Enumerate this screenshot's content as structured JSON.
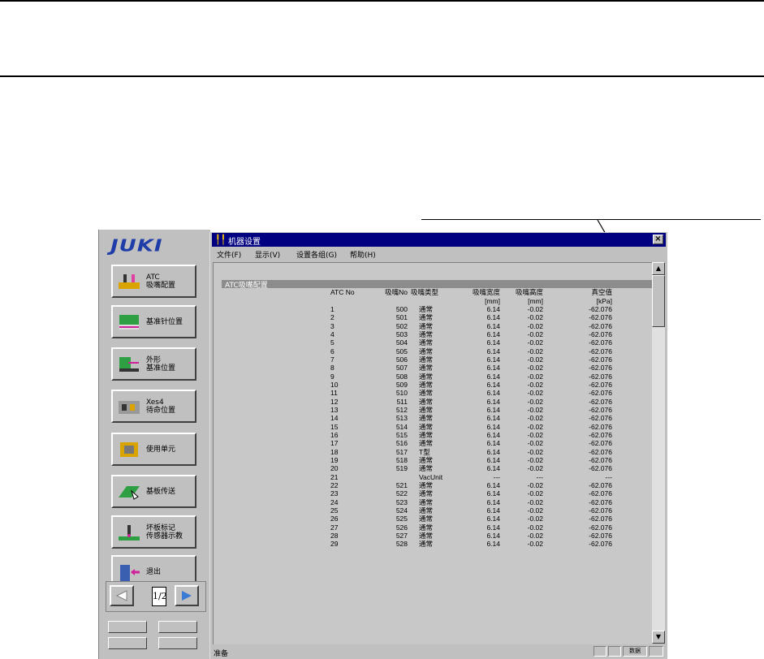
{
  "window": {
    "title": "机器设置",
    "close_label": "×",
    "menu": [
      "文件(F)",
      "显示(V)",
      "设置各组(G)",
      "帮助(H)"
    ],
    "section_title": "ATC吸嘴配置",
    "status_text": "准备",
    "status_panels": [
      "",
      "",
      "数据",
      ""
    ]
  },
  "left_panel": {
    "logo": "JUKI",
    "buttons": [
      {
        "label": "ATC\n吸嘴配置",
        "icon": "atc-nozzle-icon"
      },
      {
        "label": "基准针位置",
        "icon": "reference-pin-icon"
      },
      {
        "label": "外形\n基准位置",
        "icon": "outline-reference-icon"
      },
      {
        "label": "Xes4\n待命位置",
        "icon": "standby-position-icon"
      },
      {
        "label": "使用单元",
        "icon": "unit-icon"
      },
      {
        "label": "基板传送",
        "icon": "board-transfer-icon"
      },
      {
        "label": "坏板标记\n传感器示教",
        "icon": "bad-mark-sensor-icon"
      },
      {
        "label": "退出",
        "icon": "exit-door-icon"
      }
    ],
    "page_indicator": "1/2"
  },
  "table": {
    "headers": [
      "ATC No",
      "吸嘴No",
      "吸嘴类型",
      "吸嘴宽度",
      "吸嘴高度",
      "真空值"
    ],
    "units": [
      "",
      "",
      "",
      "[mm]",
      "[mm]",
      "[kPa]"
    ],
    "rows": [
      [
        "1",
        "500",
        "通常",
        "6.14",
        "-0.02",
        "-62.076"
      ],
      [
        "2",
        "501",
        "通常",
        "6.14",
        "-0.02",
        "-62.076"
      ],
      [
        "3",
        "502",
        "通常",
        "6.14",
        "-0.02",
        "-62.076"
      ],
      [
        "4",
        "503",
        "通常",
        "6.14",
        "-0.02",
        "-62.076"
      ],
      [
        "5",
        "504",
        "通常",
        "6.14",
        "-0.02",
        "-62.076"
      ],
      [
        "6",
        "505",
        "通常",
        "6.14",
        "-0.02",
        "-62.076"
      ],
      [
        "7",
        "506",
        "通常",
        "6.14",
        "-0.02",
        "-62.076"
      ],
      [
        "8",
        "507",
        "通常",
        "6.14",
        "-0.02",
        "-62.076"
      ],
      [
        "9",
        "508",
        "通常",
        "6.14",
        "-0.02",
        "-62.076"
      ],
      [
        "10",
        "509",
        "通常",
        "6.14",
        "-0.02",
        "-62.076"
      ],
      [
        "11",
        "510",
        "通常",
        "6.14",
        "-0.02",
        "-62.076"
      ],
      [
        "12",
        "511",
        "通常",
        "6.14",
        "-0.02",
        "-62.076"
      ],
      [
        "13",
        "512",
        "通常",
        "6.14",
        "-0.02",
        "-62.076"
      ],
      [
        "14",
        "513",
        "通常",
        "6.14",
        "-0.02",
        "-62.076"
      ],
      [
        "15",
        "514",
        "通常",
        "6.14",
        "-0.02",
        "-62.076"
      ],
      [
        "16",
        "515",
        "通常",
        "6.14",
        "-0.02",
        "-62.076"
      ],
      [
        "17",
        "516",
        "通常",
        "6.14",
        "-0.02",
        "-62.076"
      ],
      [
        "18",
        "517",
        "T型",
        "6.14",
        "-0.02",
        "-62.076"
      ],
      [
        "19",
        "518",
        "通常",
        "6.14",
        "-0.02",
        "-62.076"
      ],
      [
        "20",
        "519",
        "通常",
        "6.14",
        "-0.02",
        "-62.076"
      ],
      [
        "21",
        "",
        "VacUnit",
        "---",
        "---",
        "---"
      ],
      [
        "22",
        "521",
        "通常",
        "6.14",
        "-0.02",
        "-62.076"
      ],
      [
        "23",
        "522",
        "通常",
        "6.14",
        "-0.02",
        "-62.076"
      ],
      [
        "24",
        "523",
        "通常",
        "6.14",
        "-0.02",
        "-62.076"
      ],
      [
        "25",
        "524",
        "通常",
        "6.14",
        "-0.02",
        "-62.076"
      ],
      [
        "26",
        "525",
        "通常",
        "6.14",
        "-0.02",
        "-62.076"
      ],
      [
        "27",
        "526",
        "通常",
        "6.14",
        "-0.02",
        "-62.076"
      ],
      [
        "28",
        "527",
        "通常",
        "6.14",
        "-0.02",
        "-62.076"
      ],
      [
        "29",
        "528",
        "通常",
        "6.14",
        "-0.02",
        "-62.076"
      ]
    ]
  }
}
